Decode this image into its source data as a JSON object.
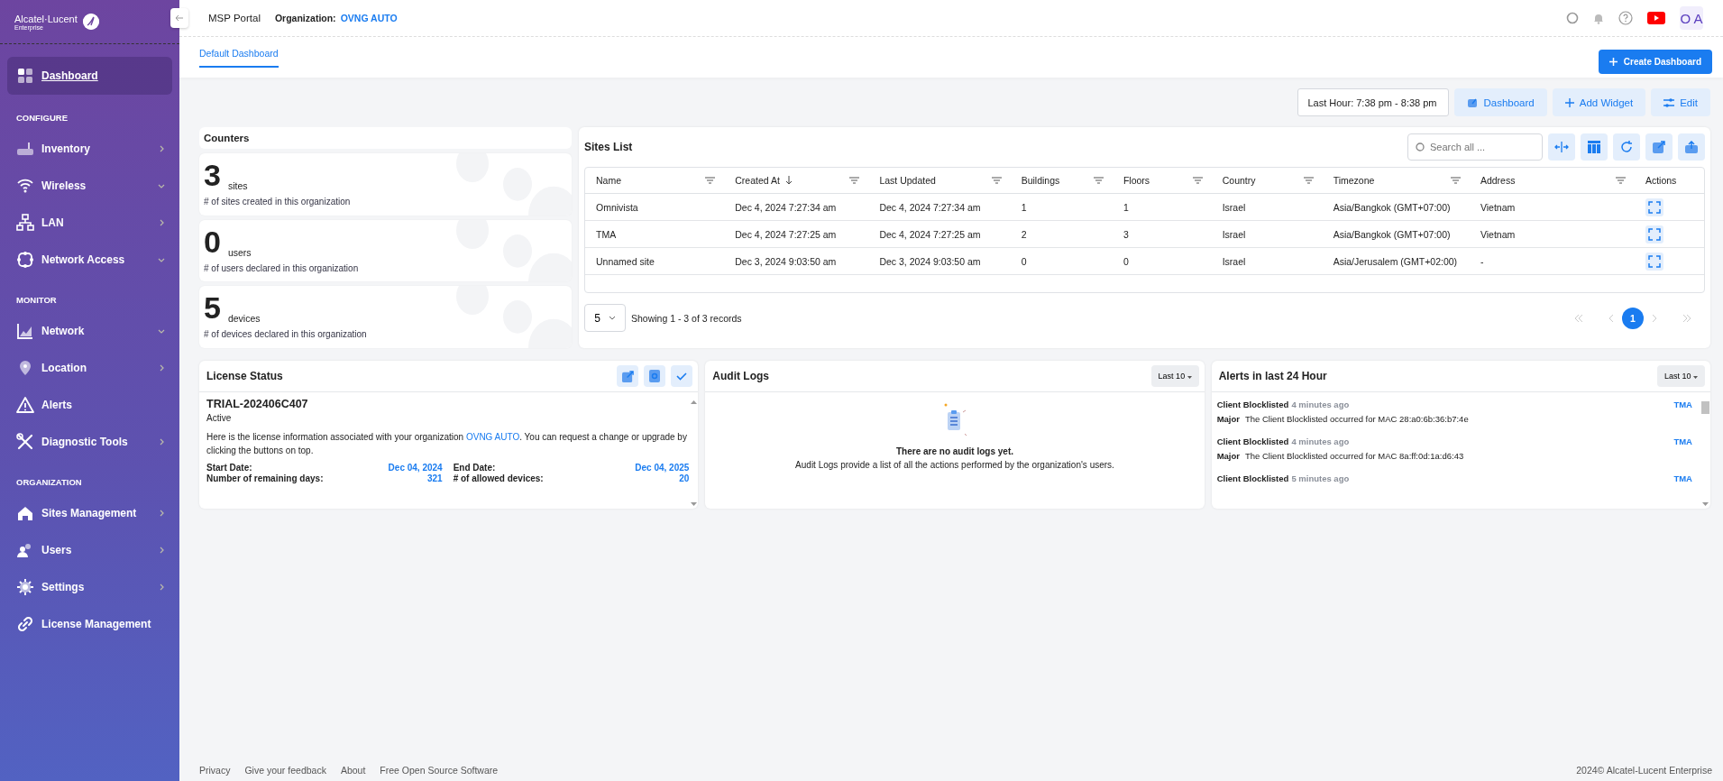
{
  "sidebar": {
    "brand": "Alcatel·Lucent",
    "brand_sub": "Enterprise",
    "sections": [
      {
        "items": [
          {
            "label": "Dashboard",
            "selected": true
          }
        ]
      },
      {
        "heading": "CONFIGURE",
        "items": [
          {
            "label": "Inventory",
            "selected": false,
            "expanded": false
          },
          {
            "label": "Wireless",
            "selected": false,
            "expanded": true
          },
          {
            "label": "LAN",
            "selected": false,
            "expanded": false
          },
          {
            "label": "Network Access",
            "selected": false,
            "expanded": true
          }
        ]
      },
      {
        "heading": "MONITOR",
        "items": [
          {
            "label": "Network",
            "selected": false,
            "expanded": true
          },
          {
            "label": "Location",
            "selected": false,
            "expanded": false
          },
          {
            "label": "Alerts",
            "selected": false
          },
          {
            "label": "Diagnostic Tools",
            "selected": false,
            "expanded": false
          }
        ]
      },
      {
        "heading": "ORGANIZATION",
        "items": [
          {
            "label": "Sites Management",
            "selected": false,
            "expanded": false
          },
          {
            "label": "Users",
            "selected": false,
            "expanded": false
          },
          {
            "label": "Settings",
            "selected": false,
            "expanded": false
          },
          {
            "label": "License Management",
            "selected": false
          }
        ]
      }
    ]
  },
  "topbar": {
    "title": "MSP Portal",
    "org_label": "Organization:",
    "org_value": "OVNG AUTO",
    "avatar": "O A"
  },
  "tabs": [
    {
      "label": "Default Dashboard",
      "selected": true
    }
  ],
  "create_button": "Create Dashboard",
  "toolbar": {
    "time_range": "Last Hour: 7:38 pm - 8:38 pm",
    "buttons": [
      "Dashboard",
      "Add Widget",
      "Edit"
    ]
  },
  "counters": {
    "title": "Counters",
    "items": [
      {
        "value": "3",
        "unit": "sites",
        "description": "# of sites created in this organization"
      },
      {
        "value": "0",
        "unit": "users",
        "description": "# of users declared in this organization"
      },
      {
        "value": "5",
        "unit": "devices",
        "description": "# of devices declared in this organization"
      }
    ]
  },
  "sites_list": {
    "title": "Sites List",
    "search_placeholder": "Search all ...",
    "columns": [
      {
        "label": "Name",
        "filter": true,
        "sorted": false
      },
      {
        "label": "Created At",
        "filter": true,
        "sorted": true
      },
      {
        "label": "Last Updated",
        "filter": true,
        "sorted": false
      },
      {
        "label": "Buildings",
        "filter": true,
        "sorted": false
      },
      {
        "label": "Floors",
        "filter": true,
        "sorted": false
      },
      {
        "label": "Country",
        "filter": true,
        "sorted": false
      },
      {
        "label": "Timezone",
        "filter": true,
        "sorted": false
      },
      {
        "label": "Address",
        "filter": true,
        "sorted": false
      },
      {
        "label": "Actions",
        "filter": false,
        "sorted": false
      }
    ],
    "rows": [
      [
        "Omnivista",
        "Dec 4, 2024 7:27:34 am",
        "Dec 4, 2024 7:27:34 am",
        "1",
        "1",
        "Israel",
        "Asia/Bangkok (GMT+07:00)",
        "Vietnam"
      ],
      [
        "TMA",
        "Dec 4, 2024 7:27:25 am",
        "Dec 4, 2024 7:27:25 am",
        "2",
        "3",
        "Israel",
        "Asia/Bangkok (GMT+07:00)",
        "Vietnam"
      ],
      [
        "Unnamed site",
        "Dec 3, 2024 9:03:50 am",
        "Dec 3, 2024 9:03:50 am",
        "0",
        "0",
        "Israel",
        "Asia/Jerusalem (GMT+02:00)",
        "-"
      ]
    ],
    "page_size": "5",
    "showing": "Showing 1 - 3 of 3 records",
    "pages": [
      {
        "label": "1",
        "selected": true
      }
    ]
  },
  "license": {
    "title": "License Status",
    "id": "TRIAL-202406C407",
    "status": "Active",
    "text_before": "Here is the license information associated with your organization",
    "link": "OVNG AUTO",
    "text_after": ". You can request a change or upgrade by clicking the buttons on top.",
    "fields": [
      {
        "label": "Start Date:",
        "value": "Dec 04, 2024"
      },
      {
        "label": "End Date:",
        "value": "Dec 04, 2025"
      },
      {
        "label": "Number of remaining days:",
        "value": "321"
      },
      {
        "label": "# of allowed devices:",
        "value": "20"
      }
    ]
  },
  "audit_logs": {
    "title": "Audit Logs",
    "filter": "Last 10",
    "empty_title": "There are no audit logs yet.",
    "empty_text": "Audit Logs provide a list of all the actions performed by the organization's users."
  },
  "alerts": {
    "title": "Alerts in last 24 Hour",
    "filter": "Last 10",
    "items": [
      {
        "title": "Client Blocklisted",
        "time": "4 minutes ago",
        "site": "TMA",
        "severity": "Major",
        "message": "The Client Blocklisted occurred for MAC 28:a0:6b:36:b7:4e"
      },
      {
        "title": "Client Blocklisted",
        "time": "4 minutes ago",
        "site": "TMA",
        "severity": "Major",
        "message": "The Client Blocklisted occurred for MAC 8a:ff:0d:1a:d6:43"
      },
      {
        "title": "Client Blocklisted",
        "time": "5 minutes ago",
        "site": "TMA"
      }
    ]
  },
  "footer": {
    "links": [
      "Privacy",
      "Give your feedback",
      "About",
      "Free Open Source Software"
    ],
    "copyright": "2024© Alcatel-Lucent Enterprise"
  }
}
